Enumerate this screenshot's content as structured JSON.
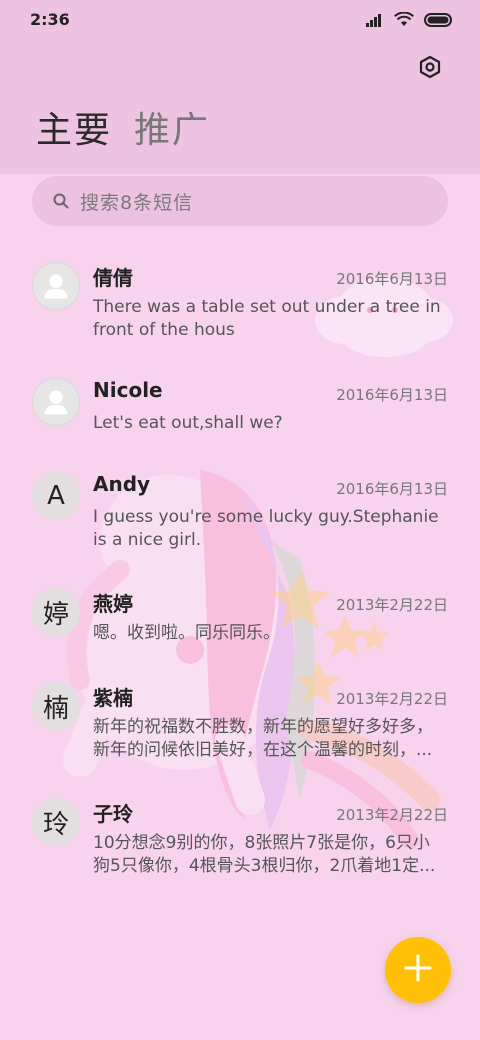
{
  "status_bar": {
    "time": "2:36",
    "icons": [
      "signal-icon",
      "wifi-icon",
      "battery-icon"
    ]
  },
  "header": {
    "settings_icon": "settings-icon",
    "tabs": [
      {
        "label": "主要",
        "active": true
      },
      {
        "label": "推广",
        "active": false
      }
    ]
  },
  "search": {
    "placeholder": "搜索8条短信"
  },
  "messages": [
    {
      "name": "倩倩",
      "date": "2016年6月13日",
      "preview": "There was a table set out under a tree in front of the hous",
      "avatar_type": "person",
      "avatar_text": ""
    },
    {
      "name": "Nicole",
      "date": "2016年6月13日",
      "preview": "Let's eat out,shall we?",
      "avatar_type": "person",
      "avatar_text": ""
    },
    {
      "name": "Andy",
      "date": "2016年6月13日",
      "preview": "I guess you're some lucky guy.Stephanie is a nice girl.",
      "avatar_type": "letter",
      "avatar_text": "A"
    },
    {
      "name": "燕婷",
      "date": "2013年2月22日",
      "preview": "嗯。收到啦。同乐同乐。",
      "avatar_type": "letter",
      "avatar_text": "婷"
    },
    {
      "name": "紫楠",
      "date": "2013年2月22日",
      "preview": "新年的祝福数不胜数，新年的愿望好多好多，新年的问候依旧美好，在这个温馨的时刻，...",
      "avatar_type": "letter",
      "avatar_text": "楠"
    },
    {
      "name": "子玲",
      "date": "2013年2月22日",
      "preview": "10分想念9别的你，8张照片7张是你，6只小狗5只像你，4根骨头3根归你，2爪着地1定...",
      "avatar_type": "letter",
      "avatar_text": "玲"
    }
  ],
  "fab": {
    "icon": "plus-icon",
    "color": "#ffc107"
  },
  "colors": {
    "background": "#f8d3ee",
    "header": "#ecc3e1",
    "accent": "#ffc107"
  }
}
